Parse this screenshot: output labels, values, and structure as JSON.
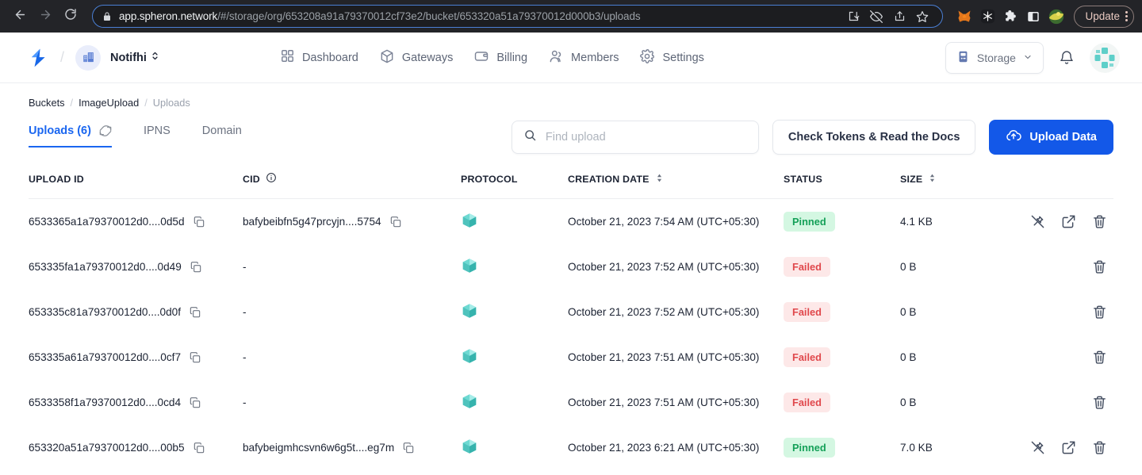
{
  "browser": {
    "back_icon": "back-arrow-icon",
    "forward_icon": "forward-arrow-icon",
    "reload_icon": "reload-icon",
    "lock_icon": "lock-icon",
    "url_host": "app.spheron.network",
    "url_path": "/#/storage/org/653208a91a79370012cf73e2/bucket/653320a51a79370012d000b3/uploads",
    "omni_icons": [
      "install-app-icon",
      "eye-slash-icon",
      "share-icon",
      "bookmark-star-icon"
    ],
    "extension_icons": [
      "metamask-fox-icon",
      "snowflake-extension-icon",
      "puzzle-extensions-icon",
      "sidebar-panel-icon",
      "profile-avatar-icon"
    ],
    "update_label": "Update",
    "menu_icon": "kebab-menu-icon"
  },
  "header": {
    "logo": "spheron-logo",
    "separator": "/",
    "org": {
      "avatar_icon": "organization-building-icon",
      "name": "Notifhi",
      "chevron_icon": "chevron-up-down-icon"
    },
    "nav": [
      {
        "label": "Dashboard",
        "icon": "grid-dashboard-icon"
      },
      {
        "label": "Gateways",
        "icon": "cube-gateway-icon"
      },
      {
        "label": "Billing",
        "icon": "credit-card-icon"
      },
      {
        "label": "Members",
        "icon": "users-icon"
      },
      {
        "label": "Settings",
        "icon": "gear-icon"
      }
    ],
    "storage_select": {
      "label": "Storage",
      "icon": "server-storage-icon",
      "chevron_icon": "chevron-down-icon"
    },
    "bell_icon": "notification-bell-icon",
    "user_avatar": "user-avatar"
  },
  "breadcrumb": [
    {
      "label": "Buckets",
      "muted": false
    },
    {
      "label": "ImageUpload",
      "muted": false
    },
    {
      "label": "Uploads",
      "muted": true
    }
  ],
  "tabs": [
    {
      "label": "Uploads (6)",
      "active": true,
      "refresh_icon": "refresh-icon"
    },
    {
      "label": "IPNS",
      "active": false
    },
    {
      "label": "Domain",
      "active": false
    }
  ],
  "search": {
    "placeholder": "Find upload",
    "value": "",
    "icon": "search-icon"
  },
  "buttons": {
    "docs_label": "Check Tokens & Read the Docs",
    "upload_label": "Upload Data",
    "upload_icon": "cloud-upload-icon"
  },
  "table": {
    "columns": [
      {
        "label": "UPLOAD ID",
        "info": false,
        "sortable": false
      },
      {
        "label": "CID",
        "info": true,
        "sortable": false
      },
      {
        "label": "PROTOCOL",
        "info": false,
        "sortable": false
      },
      {
        "label": "CREATION DATE",
        "info": false,
        "sortable": true
      },
      {
        "label": "STATUS",
        "info": false,
        "sortable": false
      },
      {
        "label": "SIZE",
        "info": false,
        "sortable": true
      },
      {
        "label": "",
        "info": false,
        "sortable": false
      }
    ],
    "rows": [
      {
        "upload_id": "6533365a1a79370012d0....0d5d",
        "cid": "bafybeibfn5g47prcyjn....5754",
        "has_cid": true,
        "protocol": "ipfs-cube-icon",
        "creation_date": "October 21, 2023 7:54 AM (UTC+05:30)",
        "status": "Pinned",
        "status_kind": "pinned",
        "size": "4.1 KB",
        "actions": [
          "unpin-icon",
          "open-external-icon",
          "delete-icon"
        ]
      },
      {
        "upload_id": "653335fa1a79370012d0....0d49",
        "cid": "-",
        "has_cid": false,
        "protocol": "ipfs-cube-icon",
        "creation_date": "October 21, 2023 7:52 AM (UTC+05:30)",
        "status": "Failed",
        "status_kind": "failed",
        "size": "0 B",
        "actions": [
          "delete-icon"
        ]
      },
      {
        "upload_id": "653335c81a79370012d0....0d0f",
        "cid": "-",
        "has_cid": false,
        "protocol": "ipfs-cube-icon",
        "creation_date": "October 21, 2023 7:52 AM (UTC+05:30)",
        "status": "Failed",
        "status_kind": "failed",
        "size": "0 B",
        "actions": [
          "delete-icon"
        ]
      },
      {
        "upload_id": "653335a61a79370012d0....0cf7",
        "cid": "-",
        "has_cid": false,
        "protocol": "ipfs-cube-icon",
        "creation_date": "October 21, 2023 7:51 AM (UTC+05:30)",
        "status": "Failed",
        "status_kind": "failed",
        "size": "0 B",
        "actions": [
          "delete-icon"
        ]
      },
      {
        "upload_id": "6533358f1a79370012d0....0cd4",
        "cid": "-",
        "has_cid": false,
        "protocol": "ipfs-cube-icon",
        "creation_date": "October 21, 2023 7:51 AM (UTC+05:30)",
        "status": "Failed",
        "status_kind": "failed",
        "size": "0 B",
        "actions": [
          "delete-icon"
        ]
      },
      {
        "upload_id": "653320a51a79370012d0....00b5",
        "cid": "bafybeigmhcsvn6w6g5t....eg7m",
        "has_cid": true,
        "protocol": "ipfs-cube-icon",
        "creation_date": "October 21, 2023 6:21 AM (UTC+05:30)",
        "status": "Pinned",
        "status_kind": "pinned",
        "size": "7.0 KB",
        "actions": [
          "unpin-icon",
          "open-external-icon",
          "delete-icon"
        ]
      }
    ]
  },
  "colors": {
    "accent_blue": "#1358e8",
    "tab_active": "#1a66f0",
    "pinned_bg": "#d4f7e2",
    "pinned_fg": "#14a058",
    "failed_bg": "#fde8e8",
    "failed_fg": "#e0484c",
    "protocol_cube": "#5ecfc9"
  }
}
